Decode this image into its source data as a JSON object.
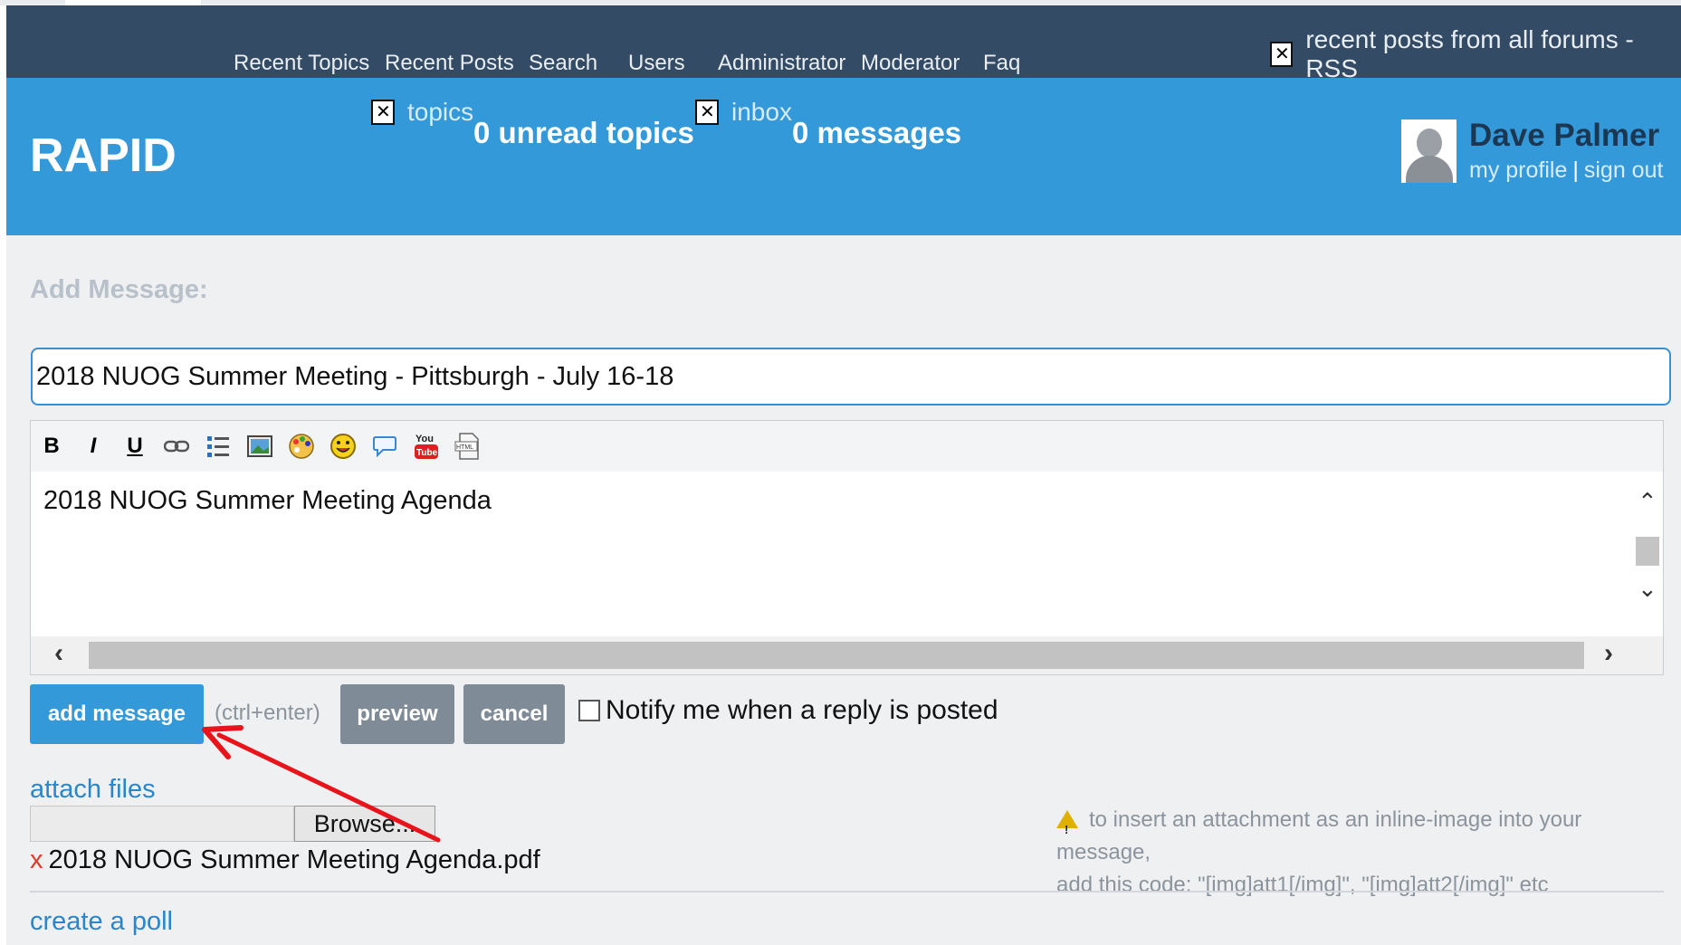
{
  "nav": {
    "items": [
      "Recent Topics",
      "Recent Posts",
      "Search",
      "Users",
      "Administrator",
      "Moderator",
      "Faq"
    ],
    "rss_label": "recent posts from all forums - RSS"
  },
  "header": {
    "brand": "RAPID",
    "topics_label": "topics",
    "unread_topics": "0 unread topics",
    "inbox_label": "inbox",
    "messages": "0 messages",
    "user_name": "Dave Palmer",
    "my_profile": "my profile",
    "separator": "|",
    "sign_out": "sign out"
  },
  "form": {
    "section_title": "Add Message:",
    "subject_value": "2018 NUOG Summer Meeting - Pittsburgh - July 16-18",
    "toolbar": {
      "bold": "B",
      "italic": "I",
      "underline": "U",
      "icons": [
        "link-icon",
        "list-icon",
        "image-icon",
        "color-palette-icon",
        "smiley-icon",
        "quote-bubble-icon",
        "youtube-icon",
        "html-icon"
      ]
    },
    "body_text": "2018 NUOG Summer Meeting Agenda",
    "add_message_label": "add message",
    "shortcut_hint": "(ctrl+enter)",
    "preview_label": "preview",
    "cancel_label": "cancel",
    "notify_label": "Notify me when a reply is posted",
    "notify_checked": false
  },
  "attachments": {
    "attach_link": "attach files",
    "browse_label": "Browse...",
    "remove_mark": "x",
    "file_name": "2018 NUOG Summer Meeting Agenda.pdf",
    "info_line1": "to insert an attachment as an inline-image into your message,",
    "info_line2": "add this code: \"[img]att1[/img]\", \"[img]att2[/img]\" etc"
  },
  "poll": {
    "link": "create a poll"
  },
  "colors": {
    "nav_bg": "#334b64",
    "header_bg": "#3499d9",
    "primary_button": "#3499d9",
    "secondary_button": "#7f8b96",
    "link": "#2a86c8",
    "annotation_arrow": "#e8141c"
  }
}
